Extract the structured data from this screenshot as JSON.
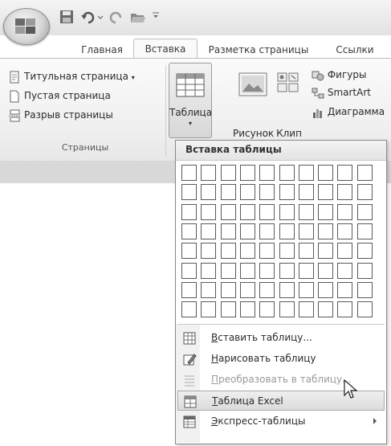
{
  "tabs": [
    "Главная",
    "Вставка",
    "Разметка страницы",
    "Ссылки"
  ],
  "active_tab": "Вставка",
  "pages_group": {
    "items": [
      "Титульная страница",
      "Пустая страница",
      "Разрыв страницы"
    ],
    "label": "Страницы"
  },
  "table_button": {
    "label": "Таблица"
  },
  "picture_button": {
    "label": "Рисунок"
  },
  "clip_button": {
    "label": "Клип"
  },
  "illustrations": [
    "Фигуры",
    "SmartArt",
    "Диаграмма"
  ],
  "dropdown": {
    "title": "Вставка таблицы",
    "grid_columns": 10,
    "grid_rows": 8,
    "menu_items": [
      {
        "label": "Вставить таблицу...",
        "underline": "В",
        "disabled": false
      },
      {
        "label": "Нарисовать таблицу",
        "underline": "Н",
        "disabled": false
      },
      {
        "label": "Преобразовать в таблицу...",
        "underline": "П",
        "disabled": true
      },
      {
        "label": "Таблица Excel",
        "underline": "Т",
        "disabled": false,
        "highlighted": true
      },
      {
        "label": "Экспресс-таблицы",
        "underline": "Э",
        "disabled": false,
        "has_submenu": true
      }
    ]
  },
  "colors": {
    "ribbon_bg": "#efefef",
    "border": "#8a8a8a",
    "hover": "#dcdcdc"
  }
}
